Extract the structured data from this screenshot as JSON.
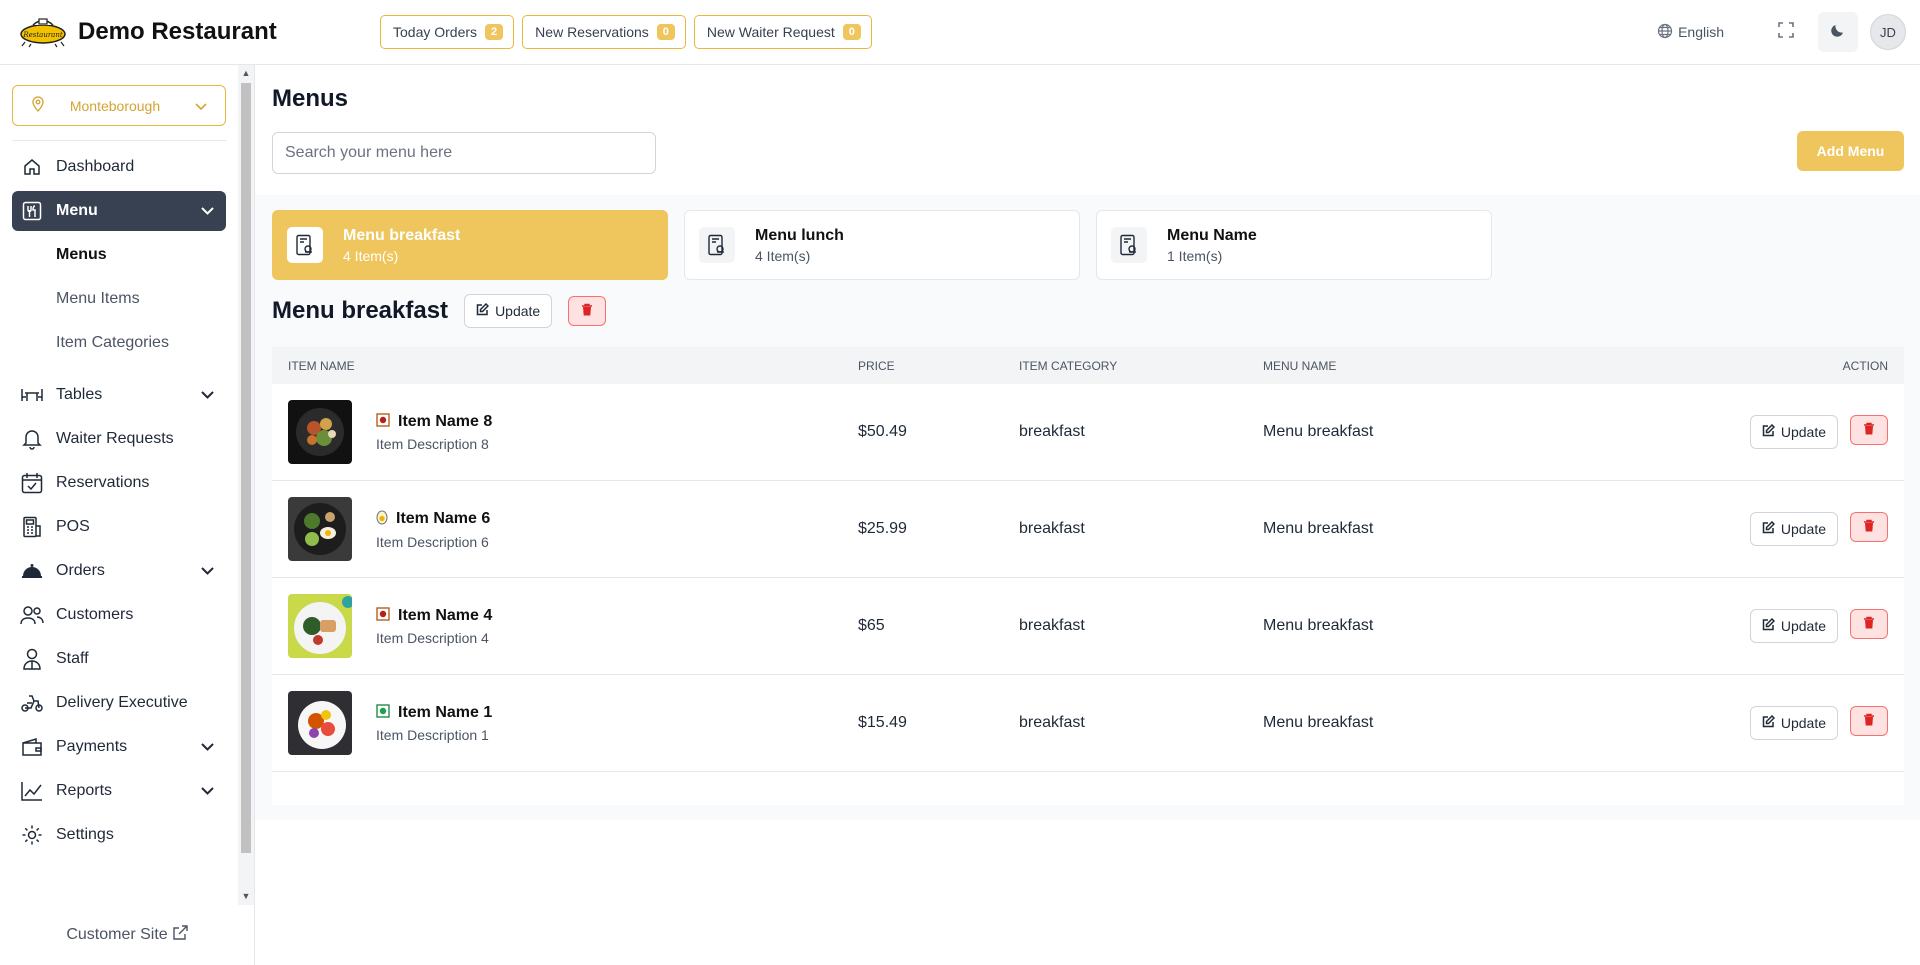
{
  "header": {
    "brand_name": "Demo Restaurant",
    "logo_text": "Restaurant",
    "pills": [
      {
        "label": "Today Orders",
        "count": "2"
      },
      {
        "label": "New Reservations",
        "count": "0"
      },
      {
        "label": "New Waiter Request",
        "count": "0"
      }
    ],
    "language": "English",
    "user_initials": "JD"
  },
  "sidebar": {
    "branch": "Monteborough",
    "items": [
      {
        "label": "Dashboard",
        "icon": "home-icon"
      },
      {
        "label": "Menu",
        "icon": "utensils-icon"
      },
      {
        "label": "Tables",
        "icon": "table-icon"
      },
      {
        "label": "Waiter Requests",
        "icon": "bell-icon"
      },
      {
        "label": "Reservations",
        "icon": "calendar-check-icon"
      },
      {
        "label": "POS",
        "icon": "pos-icon"
      },
      {
        "label": "Orders",
        "icon": "cloche-icon"
      },
      {
        "label": "Customers",
        "icon": "users-icon"
      },
      {
        "label": "Staff",
        "icon": "staff-icon"
      },
      {
        "label": "Delivery Executive",
        "icon": "scooter-icon"
      },
      {
        "label": "Payments",
        "icon": "wallet-icon"
      },
      {
        "label": "Reports",
        "icon": "chart-line-icon"
      },
      {
        "label": "Settings",
        "icon": "gear-icon"
      }
    ],
    "menu_sub": [
      "Menus",
      "Menu Items",
      "Item Categories"
    ],
    "customer_site": "Customer Site"
  },
  "main": {
    "title": "Menus",
    "search_placeholder": "Search your menu here",
    "add_menu": "Add Menu",
    "menus": [
      {
        "name": "Menu breakfast",
        "count": "4 Item(s)"
      },
      {
        "name": "Menu lunch",
        "count": "4 Item(s)"
      },
      {
        "name": "Menu Name",
        "count": "1 Item(s)"
      }
    ],
    "selected_menu": "Menu breakfast",
    "update_label": "Update",
    "columns": [
      "Item Name",
      "Price",
      "Item Category",
      "Menu Name",
      "Action"
    ],
    "rows": [
      {
        "name": "Item Name 8",
        "desc": "Item Description 8",
        "price": "$50.49",
        "category": "breakfast",
        "menu": "Menu breakfast",
        "type": "non-veg"
      },
      {
        "name": "Item Name 6",
        "desc": "Item Description 6",
        "price": "$25.99",
        "category": "breakfast",
        "menu": "Menu breakfast",
        "type": "egg"
      },
      {
        "name": "Item Name 4",
        "desc": "Item Description 4",
        "price": "$65",
        "category": "breakfast",
        "menu": "Menu breakfast",
        "type": "non-veg"
      },
      {
        "name": "Item Name 1",
        "desc": "Item Description 1",
        "price": "$15.49",
        "category": "breakfast",
        "menu": "Menu breakfast",
        "type": "veg"
      }
    ]
  },
  "colors": {
    "accent": "#eec65d",
    "sidebar_active": "#374151",
    "danger": "#dc2626"
  }
}
